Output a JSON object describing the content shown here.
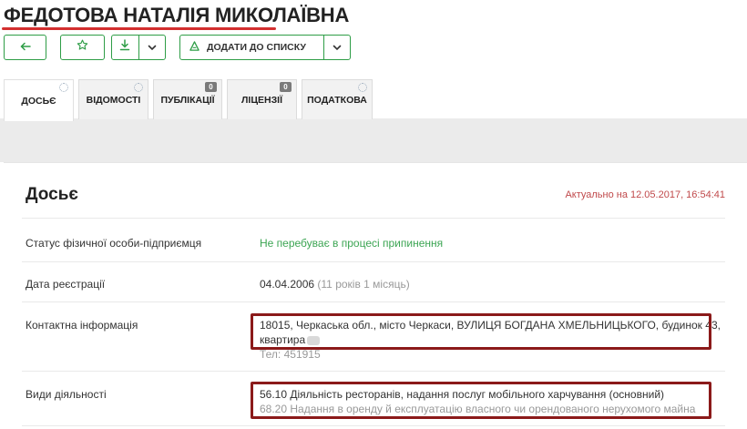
{
  "header": {
    "title": "ФЕДОТОВА НАТАЛІЯ МИКОЛАЇВНА"
  },
  "toolbar": {
    "add_to_list_label": "ДОДАТИ ДО СПИСКУ",
    "icons": [
      "arrow-left-icon",
      "star-icon",
      "download-icon",
      "chevron-down-icon",
      "list-logo-icon",
      "chevron-down-icon"
    ]
  },
  "tabs": [
    {
      "label": "ДОСЬЄ",
      "active": true,
      "indicator": "spinner"
    },
    {
      "label": "ВІДОМОСТІ",
      "active": false,
      "indicator": "spinner"
    },
    {
      "label": "ПУБЛІКАЦІЇ",
      "active": false,
      "badge": "0"
    },
    {
      "label": "ЛІЦЕНЗІЇ",
      "active": false,
      "badge": "0"
    },
    {
      "label": "ПОДАТКОВА",
      "active": false,
      "indicator": "spinner"
    }
  ],
  "dossier": {
    "title": "Досьє",
    "actual": "Актуально на 12.05.2017, 16:54:41",
    "rows": {
      "status": {
        "label": "Статус фізичної особи-підприємця",
        "value": "Не перебуває в процесі припинення"
      },
      "reg_date": {
        "label": "Дата реєстрації",
        "date": "04.04.2006",
        "duration": "(11 років 1 місяць)"
      },
      "contact": {
        "label": "Контактна інформація",
        "address_line1": "18015, Черкаська обл., місто Черкаси, ВУЛИЦЯ БОГДАНА ХМЕЛЬНИЦЬКОГО, будинок 43,",
        "address_line2": "квартира",
        "phone": "Тел: 451915"
      },
      "activities": {
        "label": "Види діяльності",
        "main": "56.10 Діяльність ресторанів, надання послуг мобільного харчування (основний)",
        "other": "68.20 Надання в оренду й експлуатацію власного чи орендованого нерухомого майна"
      }
    }
  },
  "colors": {
    "accent_green": "#2e9d46",
    "status_green": "#3ca553",
    "title_underline": "#d32f2f",
    "actual_red": "#c0494b",
    "highlight_box": "#8b1a1a"
  }
}
